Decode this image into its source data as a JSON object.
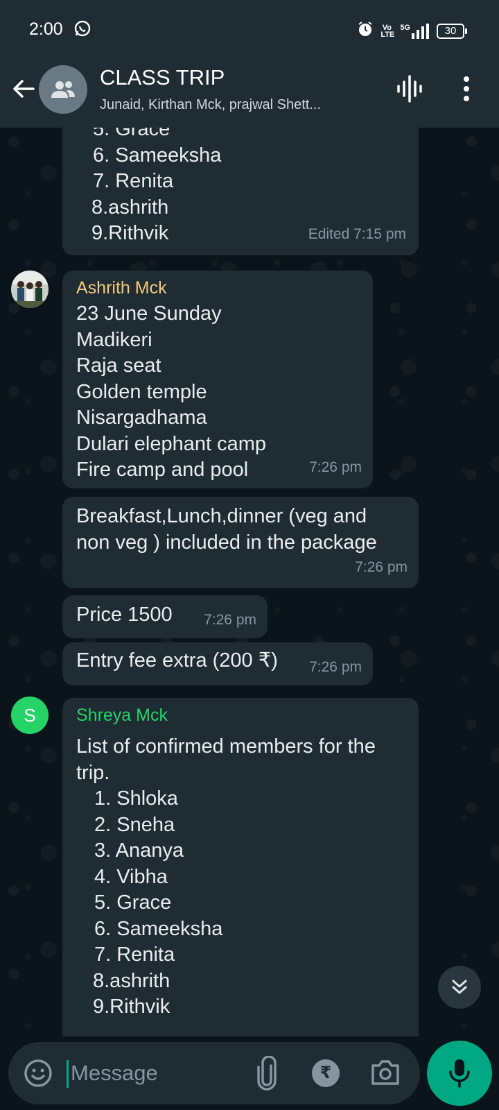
{
  "status_bar": {
    "time": "2:00",
    "volte_label": "Vo LTE",
    "network_label": "5G",
    "battery": "30"
  },
  "header": {
    "title": "CLASS TRIP",
    "subtitle": "Junaid, Kirthan Mck, prajwal Shett..."
  },
  "messages": {
    "m1": {
      "lines": [
        "5. Grace",
        "6. Sameeksha",
        "7. Renita",
        "8.ashrith",
        "9.Rithvik"
      ],
      "meta": "Edited 7:15 pm"
    },
    "m2": {
      "sender": "Ashrith Mck",
      "sender_color": "#f5c97b",
      "lines": [
        "23 June Sunday",
        "Madikeri",
        "Raja seat",
        "Golden temple",
        "Nisargadhama",
        "Dulari elephant camp",
        "Fire camp and pool"
      ],
      "time": "7:26 pm"
    },
    "m3": {
      "lines": [
        "Breakfast,Lunch,dinner (veg and",
        "non veg ) included in the package"
      ],
      "time": "7:26 pm"
    },
    "m4": {
      "text": "Price 1500",
      "time": "7:26 pm"
    },
    "m5": {
      "text": "Entry fee extra (200 ₹)",
      "time": "7:26 pm"
    },
    "m6": {
      "avatar_letter": "S",
      "sender": "Shreya Mck",
      "sender_color": "#25d366",
      "lines": [
        "List of confirmed members for the",
        "trip."
      ],
      "list": [
        "1. Shloka",
        "2. Sneha",
        "3. Ananya",
        "4. Vibha",
        "5. Grace",
        "6. Sameeksha",
        "7. Renita",
        "8.ashrith",
        "9.Rithvik"
      ]
    }
  },
  "input": {
    "placeholder": "Message",
    "rupee_label": "₹"
  },
  "colors": {
    "accent": "#00a884",
    "bubble": "#202c33",
    "header": "#1f2c34",
    "background": "#0b141a"
  }
}
